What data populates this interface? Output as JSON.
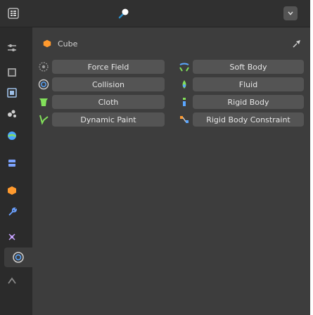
{
  "header": {
    "editor_icon": "properties-editor-icon",
    "center_icon": "physics-tab-icon",
    "dropdown_icon": "chevron-down-icon"
  },
  "tabs": [
    {
      "name": "tool",
      "icon": "tool-icon"
    },
    {
      "name": "render",
      "icon": "render-icon"
    },
    {
      "name": "output",
      "icon": "output-icon"
    },
    {
      "name": "view-layer",
      "icon": "view-layer-icon"
    },
    {
      "name": "scene",
      "icon": "scene-icon"
    },
    {
      "name": "world",
      "icon": "world-icon"
    },
    {
      "name": "object",
      "icon": "object-icon"
    },
    {
      "name": "modifiers",
      "icon": "wrench-icon"
    },
    {
      "name": "particles",
      "icon": "particles-icon"
    },
    {
      "name": "physics",
      "icon": "physics-icon",
      "active": true
    },
    {
      "name": "constraints",
      "icon": "constraints-icon"
    }
  ],
  "context": {
    "object_name": "Cube",
    "object_icon": "object-icon",
    "pin_icon": "pin-icon"
  },
  "physics": {
    "left": [
      {
        "label": "Force Field",
        "icon": "force-field-icon",
        "enabled": false
      },
      {
        "label": "Collision",
        "icon": "collision-icon",
        "enabled": false
      },
      {
        "label": "Cloth",
        "icon": "cloth-icon",
        "enabled": false
      },
      {
        "label": "Dynamic Paint",
        "icon": "dynamic-paint-icon",
        "enabled": false
      }
    ],
    "right": [
      {
        "label": "Soft Body",
        "icon": "soft-body-icon",
        "enabled": false
      },
      {
        "label": "Fluid",
        "icon": "fluid-icon",
        "enabled": false
      },
      {
        "label": "Rigid Body",
        "icon": "rigid-body-icon",
        "enabled": false
      },
      {
        "label": "Rigid Body Constraint",
        "icon": "rigid-body-constraint-icon",
        "enabled": false
      }
    ]
  },
  "colors": {
    "accent_orange": "#ff9a2e",
    "accent_green": "#82e05a",
    "accent_blue": "#4aa4ff",
    "panel_bg": "#3d3d3d",
    "button_bg": "#545454"
  }
}
